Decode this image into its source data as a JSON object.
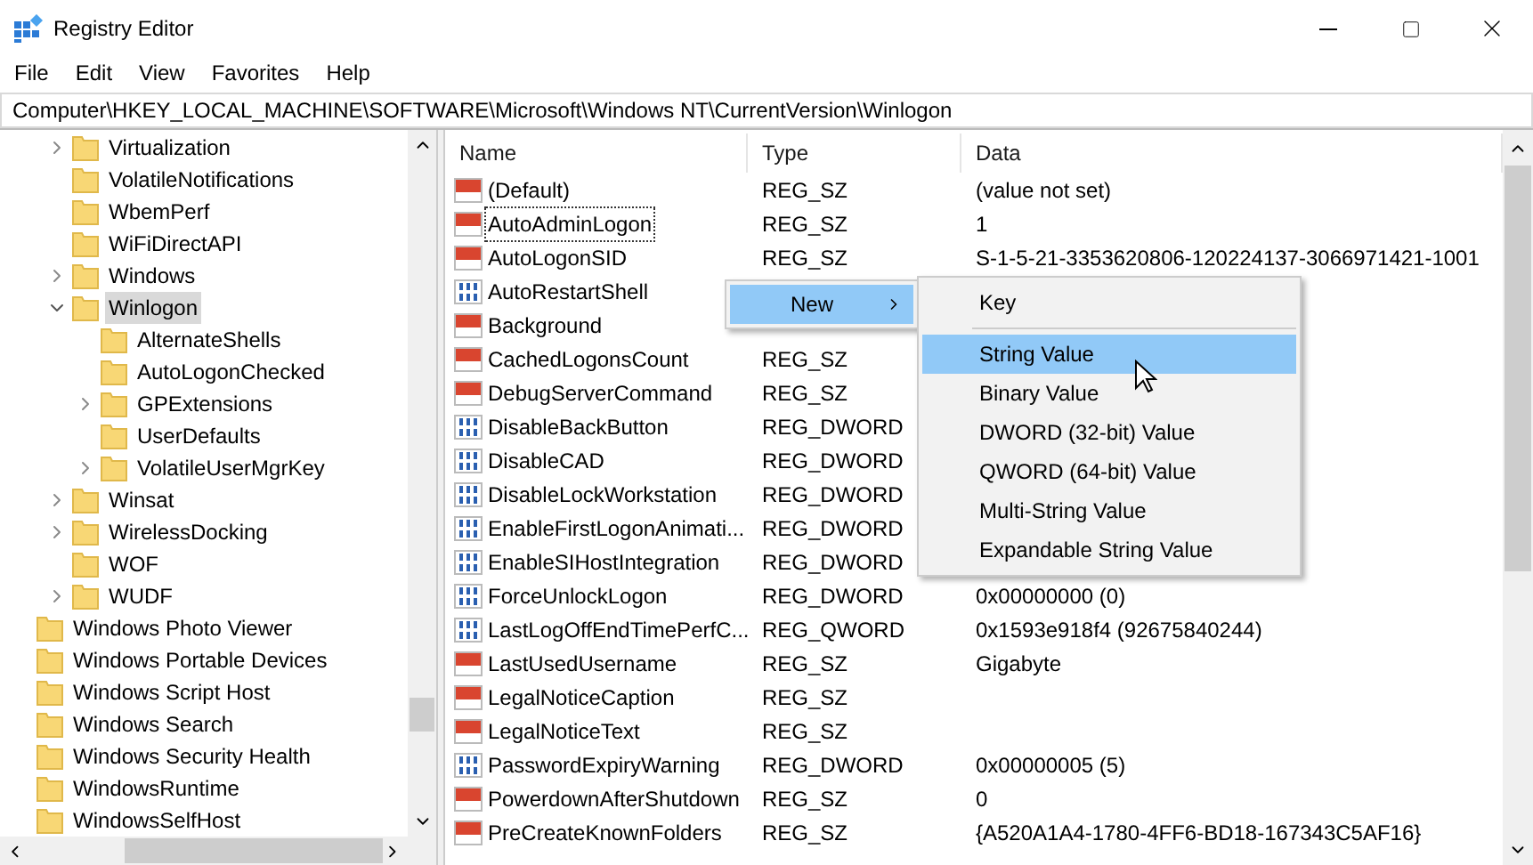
{
  "window": {
    "title": "Registry Editor"
  },
  "menu_bar": [
    "File",
    "Edit",
    "View",
    "Favorites",
    "Help"
  ],
  "address": "Computer\\HKEY_LOCAL_MACHINE\\SOFTWARE\\Microsoft\\Windows NT\\CurrentVersion\\Winlogon",
  "tree": {
    "items": [
      {
        "children": [
          {
            "label": "Virtualization",
            "expanded": false,
            "selected": false
          },
          {
            "label": "VolatileNotifications",
            "selected": false
          },
          {
            "label": "WbemPerf",
            "selected": false
          },
          {
            "label": "WiFiDirectAPI",
            "selected": false
          },
          {
            "label": "Windows",
            "expanded": false,
            "selected": false
          },
          {
            "label": "Winlogon",
            "expanded": true,
            "selected": true,
            "children": [
              {
                "label": "AlternateShells",
                "selected": false
              },
              {
                "label": "AutoLogonChecked",
                "selected": false
              },
              {
                "label": "GPExtensions",
                "expanded": false,
                "selected": false
              },
              {
                "label": "UserDefaults",
                "selected": false
              },
              {
                "label": "VolatileUserMgrKey",
                "expanded": false,
                "selected": false
              }
            ]
          },
          {
            "label": "Winsat",
            "expanded": false,
            "selected": false
          },
          {
            "label": "WirelessDocking",
            "expanded": false,
            "selected": false
          },
          {
            "label": "WOF",
            "selected": false
          },
          {
            "label": "WUDF",
            "expanded": false,
            "selected": false
          }
        ]
      },
      {
        "label": "Windows Photo Viewer",
        "selected": false
      },
      {
        "label": "Windows Portable Devices",
        "selected": false
      },
      {
        "label": "Windows Script Host",
        "selected": false
      },
      {
        "label": "Windows Search",
        "selected": false
      },
      {
        "label": "Windows Security Health",
        "selected": false
      },
      {
        "label": "WindowsRuntime",
        "selected": false
      },
      {
        "label": "WindowsSelfHost",
        "selected": false
      }
    ]
  },
  "table": {
    "columns": [
      "Name",
      "Type",
      "Data"
    ],
    "rows": [
      {
        "kind": "string",
        "name": "(Default)",
        "type": "REG_SZ",
        "data": "(value not set)",
        "focused": false
      },
      {
        "kind": "string",
        "name": "AutoAdminLogon",
        "type": "REG_SZ",
        "data": "1",
        "focused": true
      },
      {
        "kind": "string",
        "name": "AutoLogonSID",
        "type": "REG_SZ",
        "data": "S-1-5-21-3353620806-120224137-3066971421-1001",
        "focused": false
      },
      {
        "kind": "binary",
        "name": "AutoRestartShell",
        "focused": false
      },
      {
        "kind": "string",
        "name": "Background",
        "focused": false
      },
      {
        "kind": "string",
        "name": "CachedLogonsCount",
        "type": "REG_SZ",
        "focused": false
      },
      {
        "kind": "string",
        "name": "DebugServerCommand",
        "type": "REG_SZ",
        "focused": false
      },
      {
        "kind": "binary",
        "name": "DisableBackButton",
        "type": "REG_DWORD",
        "focused": false
      },
      {
        "kind": "binary",
        "name": "DisableCAD",
        "type": "REG_DWORD",
        "focused": false
      },
      {
        "kind": "binary",
        "name": "DisableLockWorkstation",
        "type": "REG_DWORD",
        "focused": false
      },
      {
        "kind": "binary",
        "name": "EnableFirstLogonAnimati...",
        "type": "REG_DWORD",
        "focused": false
      },
      {
        "kind": "binary",
        "name": "EnableSIHostIntegration",
        "type": "REG_DWORD",
        "focused": false
      },
      {
        "kind": "binary",
        "name": "ForceUnlockLogon",
        "type": "REG_DWORD",
        "data": "0x00000000 (0)",
        "focused": false
      },
      {
        "kind": "binary",
        "name": "LastLogOffEndTimePerfC...",
        "type": "REG_QWORD",
        "data": "0x1593e918f4 (92675840244)",
        "focused": false
      },
      {
        "kind": "string",
        "name": "LastUsedUsername",
        "type": "REG_SZ",
        "data": "Gigabyte",
        "focused": false
      },
      {
        "kind": "string",
        "name": "LegalNoticeCaption",
        "type": "REG_SZ",
        "focused": false
      },
      {
        "kind": "string",
        "name": "LegalNoticeText",
        "type": "REG_SZ",
        "focused": false
      },
      {
        "kind": "binary",
        "name": "PasswordExpiryWarning",
        "type": "REG_DWORD",
        "data": "0x00000005 (5)",
        "focused": false
      },
      {
        "kind": "string",
        "name": "PowerdownAfterShutdown",
        "type": "REG_SZ",
        "data": "0",
        "focused": false
      },
      {
        "kind": "string",
        "name": "PreCreateKnownFolders",
        "type": "REG_SZ",
        "data": "{A520A1A4-1780-4FF6-BD18-167343C5AF16}",
        "focused": false
      }
    ]
  },
  "context_menu": {
    "items": [
      {
        "label": "New",
        "selected": true
      }
    ],
    "submenu": [
      {
        "label": "Key",
        "selected": false,
        "separator_after": true
      },
      {
        "label": "String Value",
        "selected": true
      },
      {
        "label": "Binary Value",
        "selected": false
      },
      {
        "label": "DWORD (32-bit) Value",
        "selected": false
      },
      {
        "label": "QWORD (64-bit) Value",
        "selected": false
      },
      {
        "label": "Multi-String Value",
        "selected": false
      },
      {
        "label": "Expandable String Value",
        "selected": false
      }
    ]
  }
}
